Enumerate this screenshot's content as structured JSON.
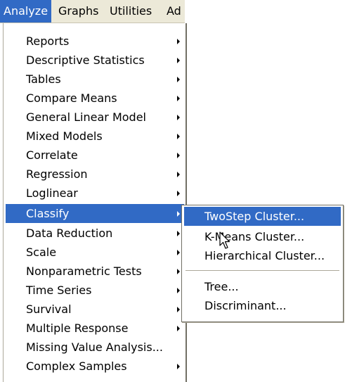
{
  "menubar": {
    "items": [
      {
        "label": "Analyze",
        "active": true
      },
      {
        "label": "Graphs",
        "active": false
      },
      {
        "label": "Utilities",
        "active": false
      },
      {
        "label": "Ad",
        "active": false
      }
    ]
  },
  "analyze_menu": {
    "items": [
      {
        "label": "Reports",
        "submenu": true
      },
      {
        "label": "Descriptive Statistics",
        "submenu": true
      },
      {
        "label": "Tables",
        "submenu": true
      },
      {
        "label": "Compare Means",
        "submenu": true
      },
      {
        "label": "General Linear Model",
        "submenu": true
      },
      {
        "label": "Mixed Models",
        "submenu": true
      },
      {
        "label": "Correlate",
        "submenu": true
      },
      {
        "label": "Regression",
        "submenu": true
      },
      {
        "label": "Loglinear",
        "submenu": true
      },
      {
        "label": "Classify",
        "submenu": true,
        "highlighted": true
      },
      {
        "label": "Data Reduction",
        "submenu": true
      },
      {
        "label": "Scale",
        "submenu": true
      },
      {
        "label": "Nonparametric Tests",
        "submenu": true
      },
      {
        "label": "Time Series",
        "submenu": true
      },
      {
        "label": "Survival",
        "submenu": true
      },
      {
        "label": "Multiple Response",
        "submenu": true
      },
      {
        "label": "Missing Value Analysis...",
        "submenu": false
      },
      {
        "label": "Complex Samples",
        "submenu": true
      }
    ]
  },
  "classify_submenu": {
    "items": [
      {
        "label": "TwoStep Cluster...",
        "highlighted": true
      },
      {
        "label": "K-Means Cluster..."
      },
      {
        "label": "Hierarchical Cluster..."
      },
      {
        "label": "Tree..."
      },
      {
        "label": "Discriminant..."
      }
    ]
  },
  "colors": {
    "highlight": "#316ac5",
    "menubar_bg": "#ece9d8",
    "menu_bg": "#ffffff"
  },
  "icons": {
    "submenu_arrow": "triangle-right-icon",
    "cursor": "mouse-pointer-icon"
  }
}
